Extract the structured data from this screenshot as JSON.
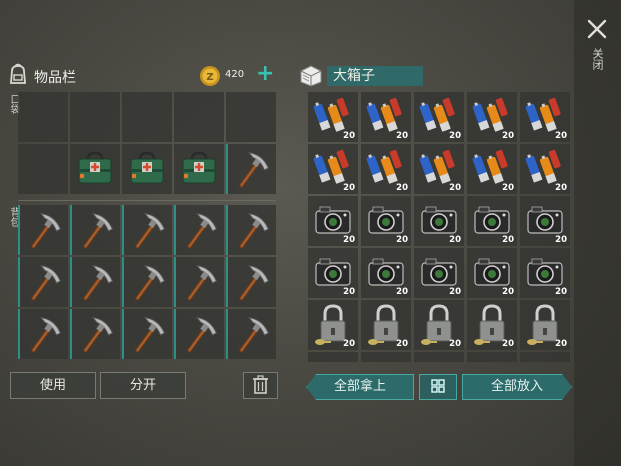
{
  "close": {
    "label": "关闭"
  },
  "inventory": {
    "title": "物品栏",
    "coins": "420",
    "pocket_label": "口袋",
    "backpack_label": "背包",
    "pocket_slots": [
      "",
      "",
      "",
      "",
      "",
      "",
      "medkit",
      "medkit",
      "medkit",
      "pickaxe"
    ],
    "backpack_slots": [
      "pickaxe",
      "pickaxe",
      "pickaxe",
      "pickaxe",
      "pickaxe",
      "pickaxe",
      "pickaxe",
      "pickaxe",
      "pickaxe",
      "pickaxe",
      "pickaxe",
      "pickaxe",
      "pickaxe",
      "pickaxe",
      "pickaxe"
    ],
    "use_label": "使用",
    "split_label": "分开"
  },
  "chest": {
    "title": "大箱子",
    "rows": [
      {
        "item": "battery",
        "counts": [
          "20",
          "20",
          "20",
          "20",
          "20"
        ]
      },
      {
        "item": "battery",
        "counts": [
          "20",
          "20",
          "20",
          "20",
          "20"
        ]
      },
      {
        "item": "camera",
        "counts": [
          "20",
          "20",
          "20",
          "20",
          "20"
        ]
      },
      {
        "item": "camera",
        "counts": [
          "20",
          "20",
          "20",
          "20",
          "20"
        ]
      },
      {
        "item": "padlock",
        "counts": [
          "20",
          "20",
          "20",
          "20",
          "20"
        ]
      }
    ],
    "take_all_label": "全部拿上",
    "put_all_label": "全部放入"
  },
  "colors": {
    "accent": "#2d6b6a",
    "teal_edge": "#2e8f8a",
    "coin": "#d9a420"
  },
  "icons": {
    "close": "close-icon",
    "bag": "backpack-icon",
    "coin": "coin-icon",
    "add": "plus-icon",
    "box": "crate-icon",
    "trash": "trash-icon",
    "sort": "grid-icon"
  }
}
